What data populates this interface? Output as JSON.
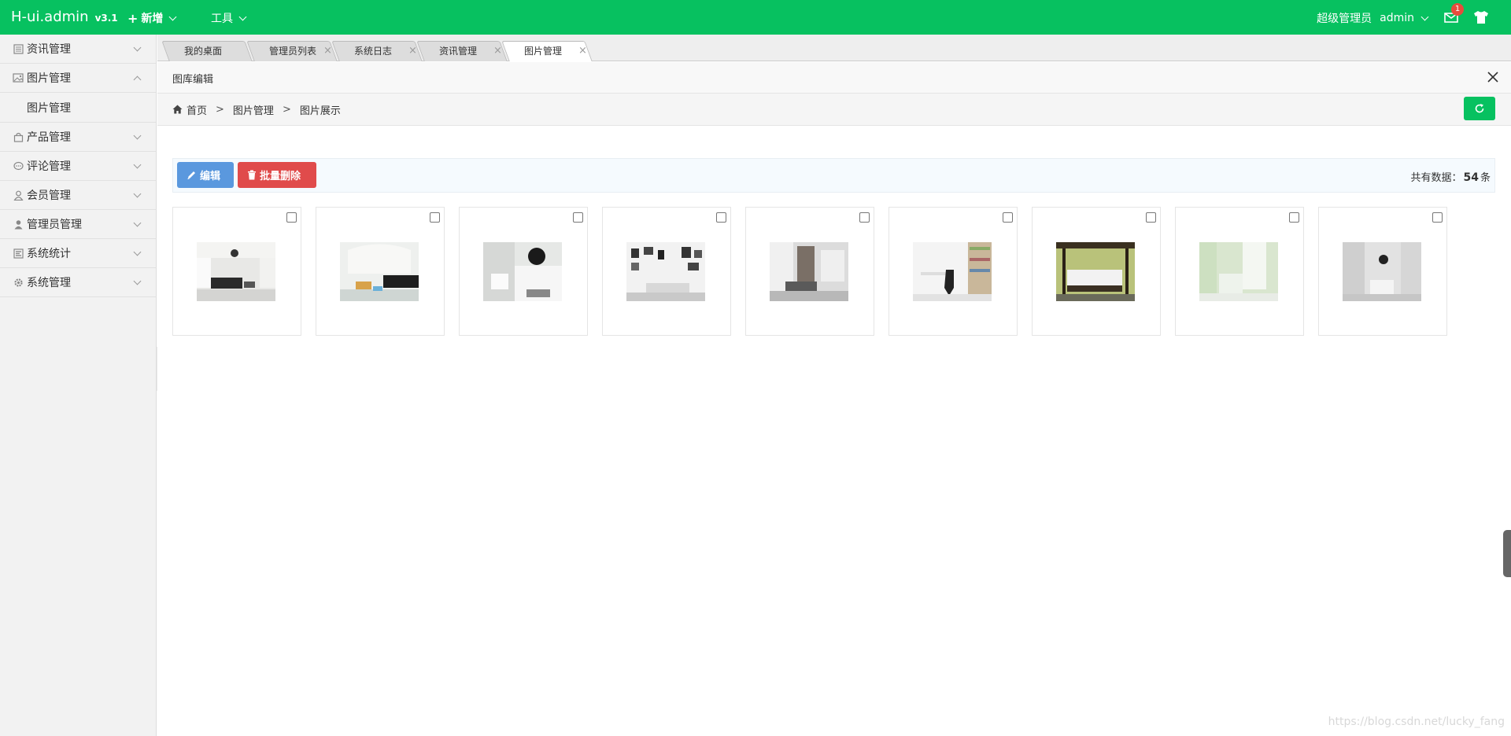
{
  "topbar": {
    "logo": "H-ui.admin",
    "version": "v3.1",
    "nav_new": "新增",
    "nav_tools": "工具",
    "role": "超级管理员",
    "username": "admin",
    "mail_badge": "1",
    "brand_color": "#07c160"
  },
  "sidebar": {
    "items": [
      {
        "label": "资讯管理",
        "icon": "news-icon"
      },
      {
        "label": "图片管理",
        "icon": "picture-icon",
        "expanded": true
      },
      {
        "label": "产品管理",
        "icon": "bag-icon"
      },
      {
        "label": "评论管理",
        "icon": "comment-icon"
      },
      {
        "label": "会员管理",
        "icon": "user-icon"
      },
      {
        "label": "管理员管理",
        "icon": "admin-icon"
      },
      {
        "label": "系统统计",
        "icon": "stats-icon"
      },
      {
        "label": "系统管理",
        "icon": "gear-icon"
      }
    ],
    "subitem": "图片管理"
  },
  "tabs": [
    {
      "label": "我的桌面",
      "closable": false
    },
    {
      "label": "管理员列表",
      "closable": true
    },
    {
      "label": "系统日志",
      "closable": true
    },
    {
      "label": "资讯管理",
      "closable": true
    },
    {
      "label": "图片管理",
      "closable": true,
      "active": true
    }
  ],
  "panel": {
    "title": "图库编辑"
  },
  "breadcrumb": {
    "home": "首页",
    "sep": ">",
    "level1": "图片管理",
    "level2": "图片展示"
  },
  "toolbar": {
    "edit_label": "编辑",
    "batch_delete_label": "批量删除",
    "total_prefix": "共有数据：",
    "total_count": "54",
    "total_suffix": "条"
  },
  "gallery": {
    "count": 9
  },
  "watermark": "https://blog.csdn.net/lucky_fang"
}
